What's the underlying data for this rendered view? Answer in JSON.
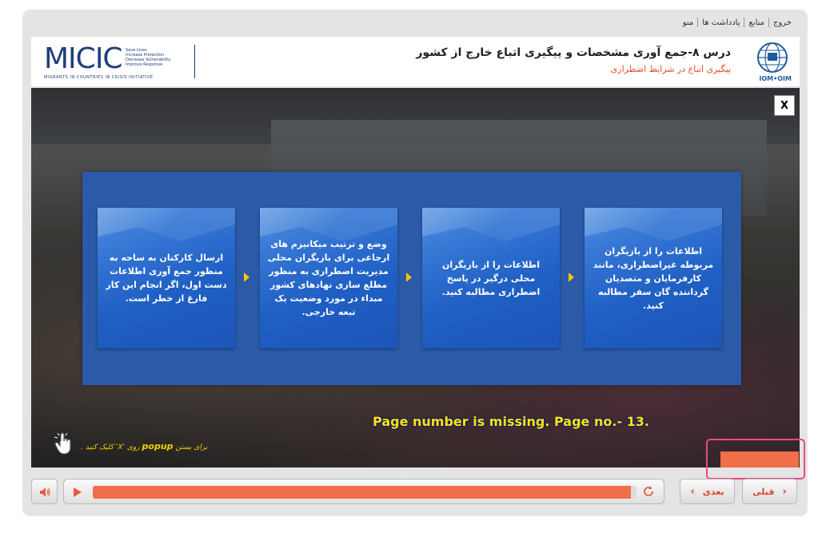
{
  "topnav": {
    "items": [
      "خروج",
      "منابع",
      "یادداشت ها",
      "منو"
    ]
  },
  "header": {
    "title": "درس ۸-جمع آوری مشخصات و پیگیری اتباع خارج از کشور",
    "subtitle": "پیگیری اتباع در شرایط اضطراری",
    "micic_logo": {
      "name": "MICIC",
      "tagline": [
        "Save Lives",
        "Increase Protection",
        "Decrease Vulnerability",
        "Improve Response"
      ],
      "subtitle": "MIGRANTS IN COUNTRIES IN CRISIS INITIATIVE"
    },
    "iom_logo": "IOM•OIM"
  },
  "popup": {
    "close_label": "X",
    "cards": [
      "اطلاعات را از بازیگران مربوطه غیراضطراری، مانند کارفرمایان و متصدیان گرداننده گان سفر مطالبه کنید.",
      "اطلاعات را از بازیگران محلی درگیر در پاسخ اضطراری مطالبه کنید.",
      "وضع و ترتیب میکانیزم های ارجاعی برای بازیگران محلی مدیریت اضطراری به منظور مطلع سازی نهادهای کشور مبداء در مورد وضعیت یک تبعه خارجی.",
      "ارسال کارکنان به ساحه به منظور جمع آوری اطلاعات دست اول، اگر انجام این کار فارغ از خطر است."
    ]
  },
  "annotation": {
    "note": "Page number is missing. Page no.- 13."
  },
  "hint": {
    "prefix": "برای بستن",
    "keyword": "popup",
    "suffix": "روی 'X' کلیک کنید ."
  },
  "controls": {
    "progress": 0.99,
    "next_label": "بعدی",
    "prev_label": "قبلی"
  },
  "colors": {
    "accent": "#f06e4a",
    "popup_bg": "#2a5aa8",
    "card_text": "#ffffff",
    "note_text": "#ffe600",
    "highlight": "#e94a86"
  },
  "icons": {
    "sound": "speaker-icon",
    "play": "play-icon",
    "refresh": "refresh-icon",
    "hand": "hand-pointer-icon",
    "arrow": "chevron-right-icon"
  }
}
